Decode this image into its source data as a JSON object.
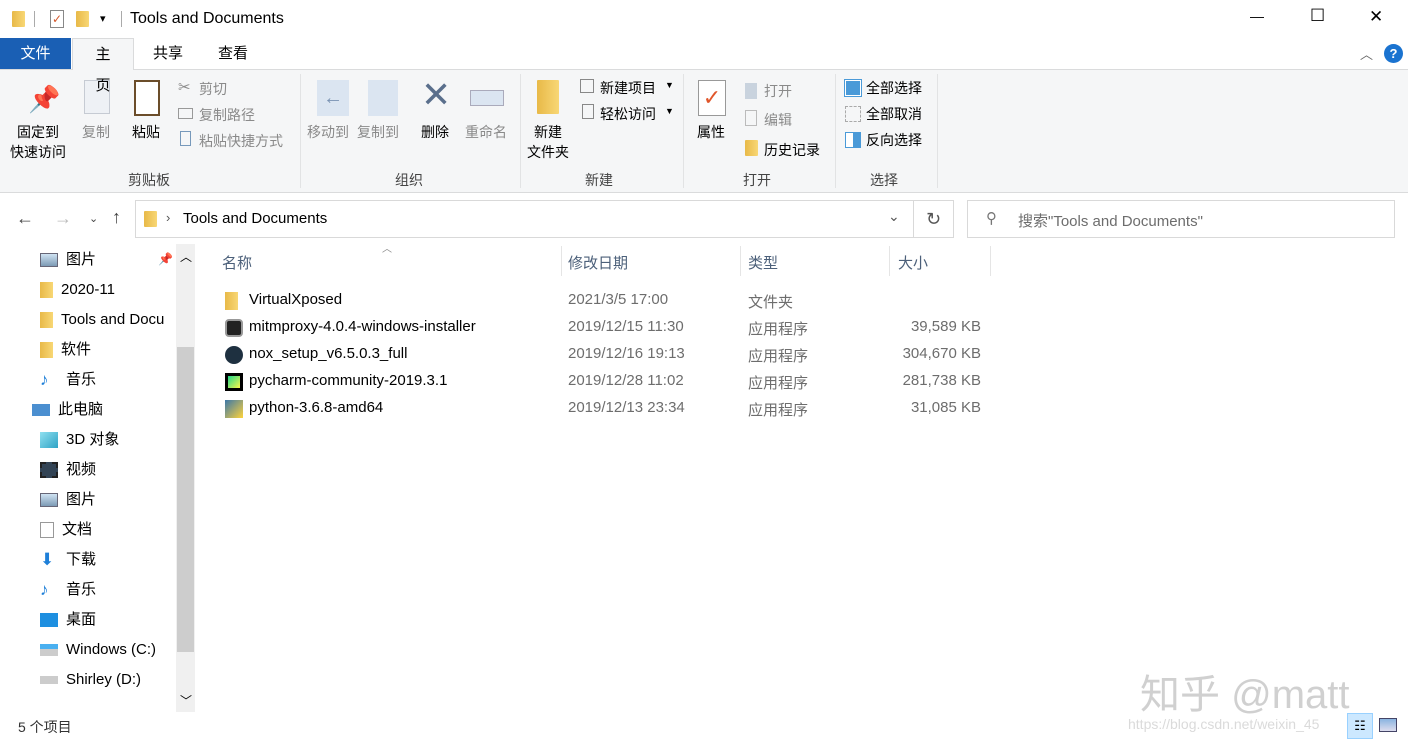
{
  "window": {
    "title": "Tools and Documents",
    "minimize": "—",
    "maximize": "☐",
    "close": "✕"
  },
  "tabs": [
    {
      "label": "文件"
    },
    {
      "label": "主页"
    },
    {
      "label": "共享"
    },
    {
      "label": "查看"
    }
  ],
  "ribbon": {
    "clipboard": {
      "group": "剪贴板",
      "pin": "固定到",
      "pin2": "快速访问",
      "copy": "复制",
      "paste": "粘贴",
      "cut": "剪切",
      "copy_path": "复制路径",
      "paste_shortcut": "粘贴快捷方式"
    },
    "organize": {
      "group": "组织",
      "move_to": "移动到",
      "copy_to": "复制到",
      "delete": "删除",
      "rename": "重命名"
    },
    "new": {
      "group": "新建",
      "new_folder": "新建",
      "new_folder2": "文件夹",
      "new_item": "新建项目",
      "easy_access": "轻松访问"
    },
    "open": {
      "group": "打开",
      "properties": "属性",
      "open": "打开",
      "edit": "编辑",
      "history": "历史记录"
    },
    "select": {
      "group": "选择",
      "select_all": "全部选择",
      "select_none": "全部取消",
      "invert": "反向选择"
    }
  },
  "address": {
    "path": "Tools and Documents",
    "search_placeholder": "搜索\"Tools and Documents\""
  },
  "columns": [
    "名称",
    "修改日期",
    "类型",
    "大小"
  ],
  "files": [
    {
      "name": "VirtualXposed",
      "date": "2021/3/5 17:00",
      "type": "文件夹",
      "size": "",
      "icon": "folder"
    },
    {
      "name": "mitmproxy-4.0.4-windows-installer",
      "date": "2019/12/15 11:30",
      "type": "应用程序",
      "size": "39,589 KB",
      "icon": "mitmproxy"
    },
    {
      "name": "nox_setup_v6.5.0.3_full",
      "date": "2019/12/16 19:13",
      "type": "应用程序",
      "size": "304,670 KB",
      "icon": "nox"
    },
    {
      "name": "pycharm-community-2019.3.1",
      "date": "2019/12/28 11:02",
      "type": "应用程序",
      "size": "281,738 KB",
      "icon": "pycharm"
    },
    {
      "name": "python-3.6.8-amd64",
      "date": "2019/12/13 23:34",
      "type": "应用程序",
      "size": "31,085 KB",
      "icon": "python"
    }
  ],
  "nav": [
    {
      "label": "图片",
      "icon": "pictures",
      "indent": 1
    },
    {
      "label": "2020-11",
      "icon": "folder",
      "indent": 1
    },
    {
      "label": "Tools and Docu",
      "icon": "folder",
      "indent": 1
    },
    {
      "label": "软件",
      "icon": "folder",
      "indent": 1
    },
    {
      "label": "音乐",
      "icon": "music",
      "indent": 1
    },
    {
      "label": "此电脑",
      "icon": "this-pc",
      "indent": 0
    },
    {
      "label": "3D 对象",
      "icon": "3d-objects",
      "indent": 1
    },
    {
      "label": "视频",
      "icon": "video",
      "indent": 1
    },
    {
      "label": "图片",
      "icon": "pictures",
      "indent": 1
    },
    {
      "label": "文档",
      "icon": "documents",
      "indent": 1
    },
    {
      "label": "下载",
      "icon": "downloads",
      "indent": 1
    },
    {
      "label": "音乐",
      "icon": "music",
      "indent": 1
    },
    {
      "label": "桌面",
      "icon": "desktop",
      "indent": 1
    },
    {
      "label": "Windows  (C:)",
      "icon": "drive-c",
      "indent": 1
    },
    {
      "label": "Shirley (D:)",
      "icon": "drive-d",
      "indent": 1
    }
  ],
  "status": {
    "count": "5 个项目"
  },
  "watermark": {
    "text": "知乎 @matt",
    "url": "https://blog.csdn.net/weixin_45"
  },
  "colors": {
    "file_tab": "#1a5fb4",
    "accent": "#0078d7",
    "selected_view": "#cce8ff"
  }
}
